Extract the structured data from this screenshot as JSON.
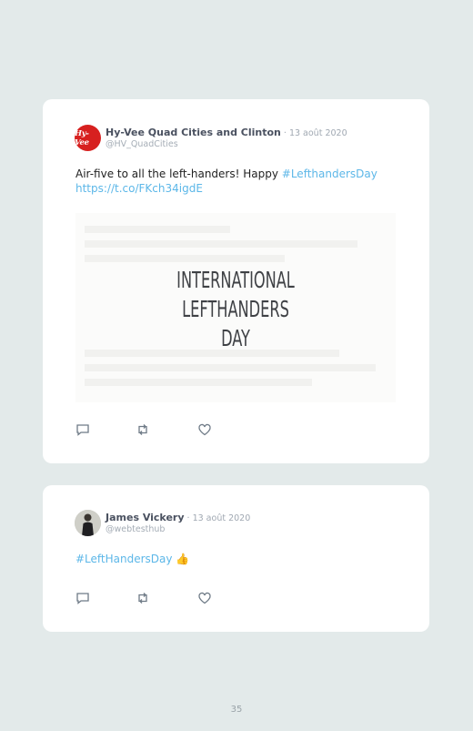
{
  "tweets": [
    {
      "avatar_text": "Hy-Vee",
      "name": "Hy-Vee Quad Cities and Clinton",
      "date_sep": " · ",
      "date": "13 août 2020",
      "handle": "@HV_QuadCities",
      "text_plain": "Air-five to all the left-handers! Happy ",
      "hashtag": "#LefthandersDay",
      "url": "https://t.co/FKch34igdE",
      "image_text": [
        "INTERNATIONAL",
        "LEFTHANDERS",
        "DAY"
      ]
    },
    {
      "name": "James Vickery",
      "date_sep": " · ",
      "date": "13 août 2020",
      "handle": "@webtesthub",
      "hashtag": "#LeftHandersDay",
      "emoji": "👍"
    }
  ],
  "icons": [
    "reply-icon",
    "retweet-icon",
    "like-icon"
  ],
  "colors": {
    "link": "#5cb7e8",
    "background": "#e3eaea",
    "card": "#ffffff",
    "icon": "#6e7a86"
  },
  "page_number": "35"
}
